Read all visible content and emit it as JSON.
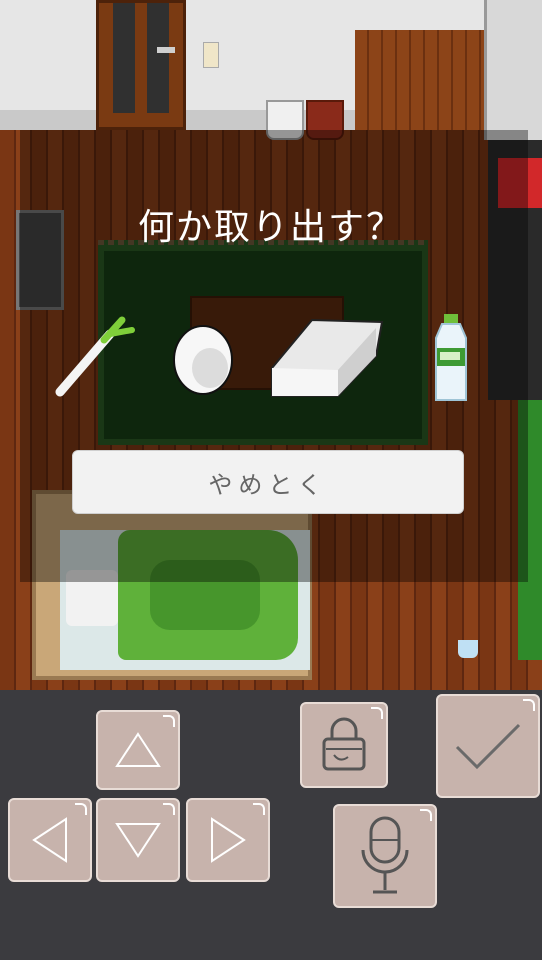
{
  "dialog": {
    "prompt": "何か取り出す？",
    "cancel_label": "やめとく"
  },
  "items": [
    {
      "name": "green-onion-icon"
    },
    {
      "name": "egg-icon"
    },
    {
      "name": "tofu-icon"
    },
    {
      "name": "water-bottle-icon"
    }
  ],
  "controls": {
    "dpad": [
      "up-arrow-icon",
      "left-arrow-icon",
      "down-arrow-icon",
      "right-arrow-icon"
    ],
    "actions": [
      "bag-icon",
      "microphone-icon",
      "checkmark-icon"
    ]
  },
  "colors": {
    "pad": "#c7b3ac",
    "panel": "#3b3b3f",
    "blanket": "#5fb13a"
  }
}
